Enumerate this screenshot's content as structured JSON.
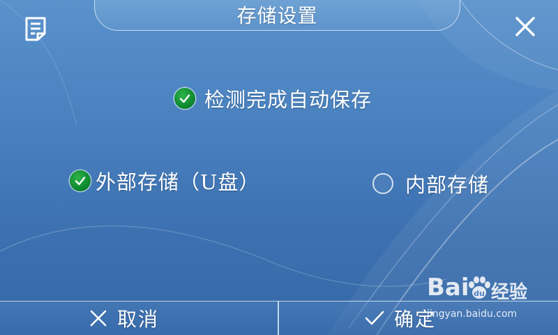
{
  "dialog": {
    "title": "存储设置",
    "icons": {
      "menu": "document-icon",
      "close": "close-icon"
    }
  },
  "options": {
    "auto_save": {
      "label": "检测完成自动保存",
      "checked": true
    },
    "external_storage": {
      "label": "外部存储（U盘）",
      "checked": true
    },
    "internal_storage": {
      "label": "内部存储",
      "checked": false
    }
  },
  "buttons": {
    "cancel": {
      "label": "取消",
      "icon": "close-icon"
    },
    "confirm": {
      "label": "确定",
      "icon": "check-icon"
    }
  },
  "watermark": {
    "brand": "Bai",
    "brand_suffix": "经验",
    "url": "jingyan.baidu.com"
  },
  "colors": {
    "background": "#4a82c0",
    "checked": "#0d8a2e",
    "text": "#ffffff"
  }
}
